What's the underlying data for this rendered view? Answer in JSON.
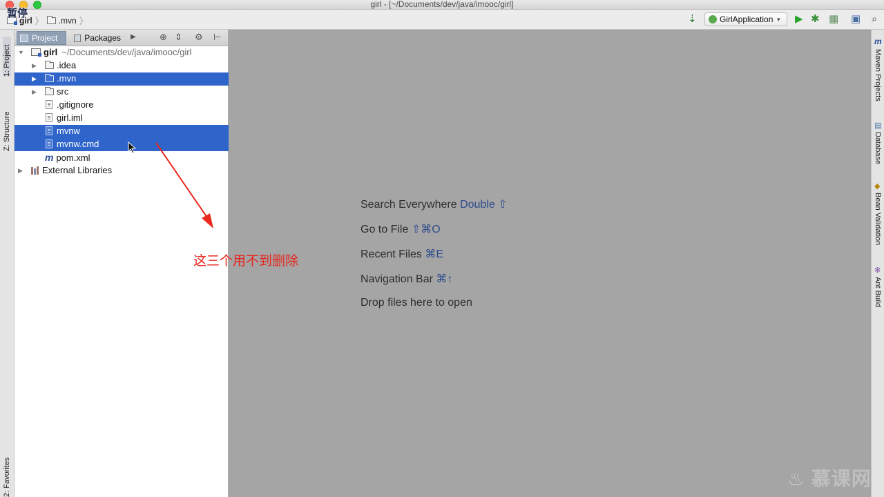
{
  "window": {
    "title": "girl - [~/Documents/dev/java/imooc/girl]",
    "overlay_text": "暂停"
  },
  "breadcrumb": {
    "root": "girl",
    "child": ".mvn"
  },
  "toolbar": {
    "run_config": "GirlApplication"
  },
  "left_stripe": {
    "project_tab": "1: Project",
    "structure_tab": "Z: Structure",
    "favorites_tab": "2: Favorites"
  },
  "project_panel": {
    "tab_project": "Project",
    "tab_packages": "Packages",
    "tree": [
      {
        "name": "girl",
        "path": "~/Documents/dev/java/imooc/girl",
        "type": "module",
        "selected": false
      },
      {
        "name": ".idea",
        "type": "folder",
        "selected": false
      },
      {
        "name": ".mvn",
        "type": "folder",
        "selected": true
      },
      {
        "name": "src",
        "type": "folder",
        "selected": false
      },
      {
        "name": ".gitignore",
        "type": "file",
        "selected": false
      },
      {
        "name": "girl.iml",
        "type": "file",
        "selected": false
      },
      {
        "name": "mvnw",
        "type": "file",
        "selected": true
      },
      {
        "name": "mvnw.cmd",
        "type": "file",
        "selected": true
      },
      {
        "name": "pom.xml",
        "type": "maven",
        "selected": false
      },
      {
        "name": "External Libraries",
        "type": "library",
        "selected": false
      }
    ]
  },
  "editor_hints": [
    {
      "label": "Search Everywhere",
      "key": "Double ⇧"
    },
    {
      "label": "Go to File",
      "key": "⇧⌘O"
    },
    {
      "label": "Recent Files",
      "key": "⌘E"
    },
    {
      "label": "Navigation Bar",
      "key": "⌘↑"
    },
    {
      "label": "Drop files here to open",
      "key": ""
    }
  ],
  "annotation": {
    "text": "这三个用不到删除",
    "color": "#e8231b"
  },
  "right_stripe": {
    "maven": "Maven Projects",
    "database": "Database",
    "bean": "Bean Validation",
    "ant": "Ant Build"
  },
  "watermark": {
    "text": "慕课网"
  }
}
